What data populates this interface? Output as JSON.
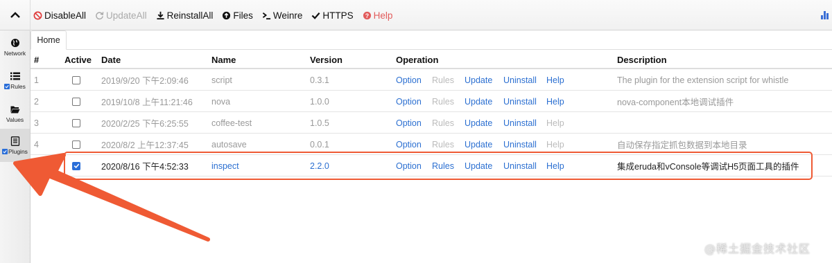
{
  "toolbar": {
    "items": [
      {
        "label": "DisableAll",
        "icon": "ban-icon",
        "state": "enabled"
      },
      {
        "label": "UpdateAll",
        "icon": "refresh-icon",
        "state": "disabled"
      },
      {
        "label": "ReinstallAll",
        "icon": "download-icon",
        "state": "enabled"
      },
      {
        "label": "Files",
        "icon": "upload-circle-icon",
        "state": "enabled"
      },
      {
        "label": "Weinre",
        "icon": "terminal-icon",
        "state": "enabled"
      },
      {
        "label": "HTTPS",
        "icon": "check-icon",
        "state": "enabled"
      },
      {
        "label": "Help",
        "icon": "question-circle-icon",
        "state": "help"
      }
    ]
  },
  "sidebar": {
    "items": [
      {
        "label": "Network",
        "icon": "globe-icon",
        "checkbox": false
      },
      {
        "label": "Rules",
        "icon": "list-icon",
        "checkbox": true
      },
      {
        "label": "Values",
        "icon": "folder-icon",
        "checkbox": false
      },
      {
        "label": "Plugins",
        "icon": "plugin-icon",
        "checkbox": true
      }
    ]
  },
  "tabs": [
    {
      "label": "Home"
    }
  ],
  "table": {
    "headers": {
      "num": "#",
      "active": "Active",
      "date": "Date",
      "name": "Name",
      "version": "Version",
      "operation": "Operation",
      "description": "Description"
    },
    "rows": [
      {
        "num": "1",
        "checked": false,
        "date": "2019/9/20 下午2:09:46",
        "name": "script",
        "version": "0.3.1",
        "ops": [
          "Option",
          "Rules",
          "Update",
          "Uninstall",
          "Help"
        ],
        "help_enabled": true,
        "rules_enabled": false,
        "description": "The plugin for the extension script for whistle"
      },
      {
        "num": "2",
        "checked": false,
        "date": "2019/10/8 上午11:21:46",
        "name": "nova",
        "version": "1.0.0",
        "ops": [
          "Option",
          "Rules",
          "Update",
          "Uninstall",
          "Help"
        ],
        "help_enabled": true,
        "rules_enabled": false,
        "description": "nova-component本地调试插件"
      },
      {
        "num": "3",
        "checked": false,
        "date": "2020/2/25 下午6:25:55",
        "name": "coffee-test",
        "version": "1.0.5",
        "ops": [
          "Option",
          "Rules",
          "Update",
          "Uninstall",
          "Help"
        ],
        "help_enabled": false,
        "rules_enabled": false,
        "description": ""
      },
      {
        "num": "4",
        "checked": false,
        "date": "2020/8/2 上午12:37:45",
        "name": "autosave",
        "version": "0.0.1",
        "ops": [
          "Option",
          "Rules",
          "Update",
          "Uninstall",
          "Help"
        ],
        "help_enabled": false,
        "rules_enabled": false,
        "description": "自动保存指定抓包数据到本地目录"
      },
      {
        "num": "",
        "checked": true,
        "date": "2020/8/16 下午4:52:33",
        "name": "inspect",
        "version": "2.2.0",
        "ops": [
          "Option",
          "Rules",
          "Update",
          "Uninstall",
          "Help"
        ],
        "help_enabled": true,
        "rules_enabled": true,
        "description": "集成eruda和vConsole等调试H5页面工具的插件"
      }
    ]
  },
  "watermark": "@稀土掘金技术社区",
  "colors": {
    "link": "#2b6fd1",
    "highlight": "#ef5a34",
    "help": "#e25c5c",
    "checkbox": "#2a6ed8"
  }
}
